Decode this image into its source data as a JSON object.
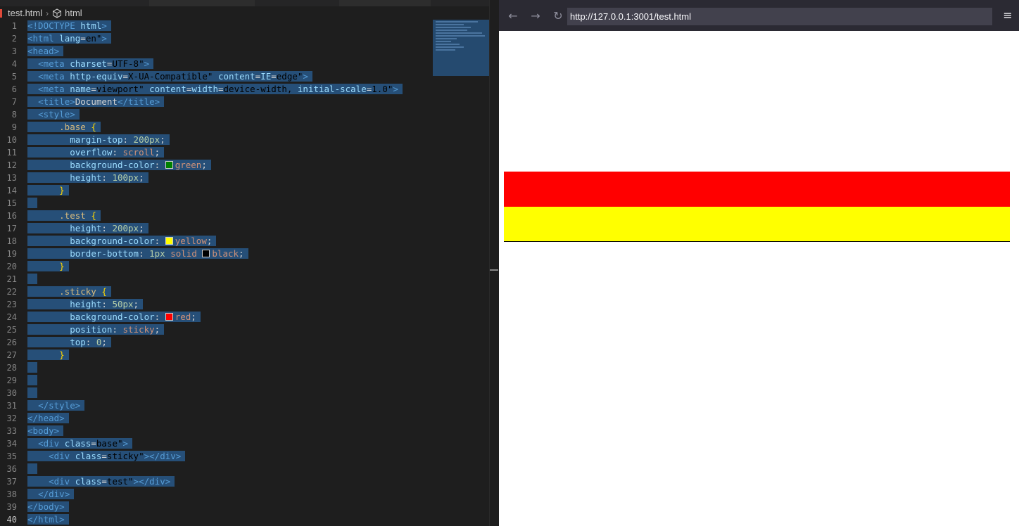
{
  "editor": {
    "breadcrumb": {
      "file": "test.html",
      "symbol": "html"
    },
    "lines": [
      "<!DOCTYPE html>",
      "<html lang=\"en\">",
      "<head>",
      "  <meta charset=\"UTF-8\">",
      "  <meta http-equiv=\"X-UA-Compatible\" content=\"IE=edge\">",
      "  <meta name=\"viewport\" content=\"width=device-width, initial-scale=1.0\">",
      "  <title>Document</title>",
      "  <style>",
      "      .base {",
      "        margin-top: 200px;",
      "        overflow: scroll;",
      "        background-color: green;",
      "        height: 100px;",
      "      }",
      "",
      "      .test {",
      "        height: 200px;",
      "        background-color: yellow;",
      "        border-bottom: 1px solid black;",
      "      }",
      "",
      "      .sticky {",
      "        height: 50px;",
      "        background-color: red;",
      "        position: sticky;",
      "        top: 0;",
      "      }",
      "",
      "",
      "",
      "  </style>",
      "</head>",
      "<body>",
      "  <div class=\"base\">",
      "    <div class=\"sticky\"></div>",
      "",
      "    <div class=\"test\"></div>",
      "  </div>",
      "</body>",
      "</html>"
    ],
    "current_line": 40
  },
  "browser": {
    "url": "http://127.0.0.1:3001/test.html",
    "icons": {
      "back": "back-arrow-icon",
      "forward": "forward-arrow-icon",
      "reload": "reload-icon",
      "menu": "hamburger-menu-icon"
    }
  },
  "preview": {
    "sticky_color": "#ff0000",
    "test_color": "#ffff00",
    "border_color": "#000000"
  },
  "colors": {
    "selection": "#264f78",
    "editor_bg": "#1e1e1e"
  }
}
